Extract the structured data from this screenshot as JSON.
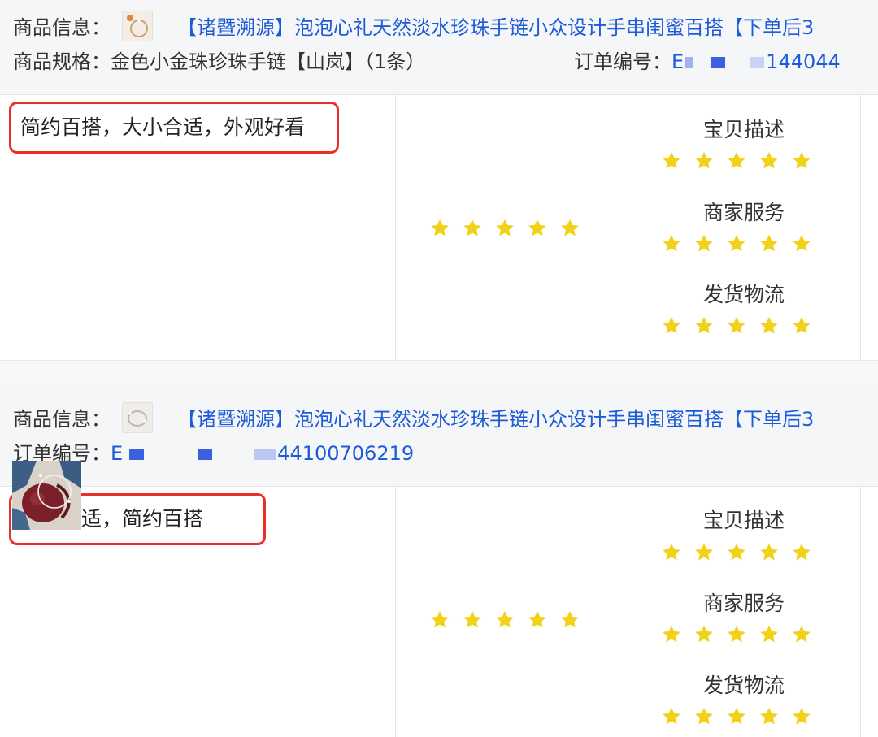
{
  "colors": {
    "link": "#1e5bd8",
    "star": "#f2d119",
    "highlight_border": "#e8302a",
    "header_bg": "#f5f6f8"
  },
  "reviews": [
    {
      "product_label": "商品信息：",
      "product_title": "【诸暨溯源】泡泡心礼天然淡水珍珠手链小众设计手串闺蜜百搭【下单后3",
      "spec_label": "商品规格：",
      "spec_value": "金色小金珠珍珠手链【山岚】（1条）",
      "order_label": "订单编号：",
      "order_prefix": "E",
      "order_suffix": "144044",
      "review_text": "简约百搭，大小合适，外观好看",
      "overall_rating": 5,
      "ratings": [
        {
          "label": "宝贝描述",
          "score": 5
        },
        {
          "label": "商家服务",
          "score": 5
        },
        {
          "label": "发货物流",
          "score": 5
        }
      ],
      "thumb_icon": "bracelet-thumbnail"
    },
    {
      "product_label": "商品信息：",
      "product_title": "【诸暨溯源】泡泡心礼天然淡水珍珠手链小众设计手串闺蜜百搭【下单后3",
      "order_label": "订单编号：",
      "order_prefix": "E",
      "order_suffix": "44100706219",
      "review_text": "大小合适，简约百搭",
      "overall_rating": 5,
      "ratings": [
        {
          "label": "宝贝描述",
          "score": 5
        },
        {
          "label": "商家服务",
          "score": 5
        },
        {
          "label": "发货物流",
          "score": 5
        }
      ],
      "thumb_icon": "bracelet-thumbnail",
      "photo_icon": "review-photo"
    }
  ]
}
